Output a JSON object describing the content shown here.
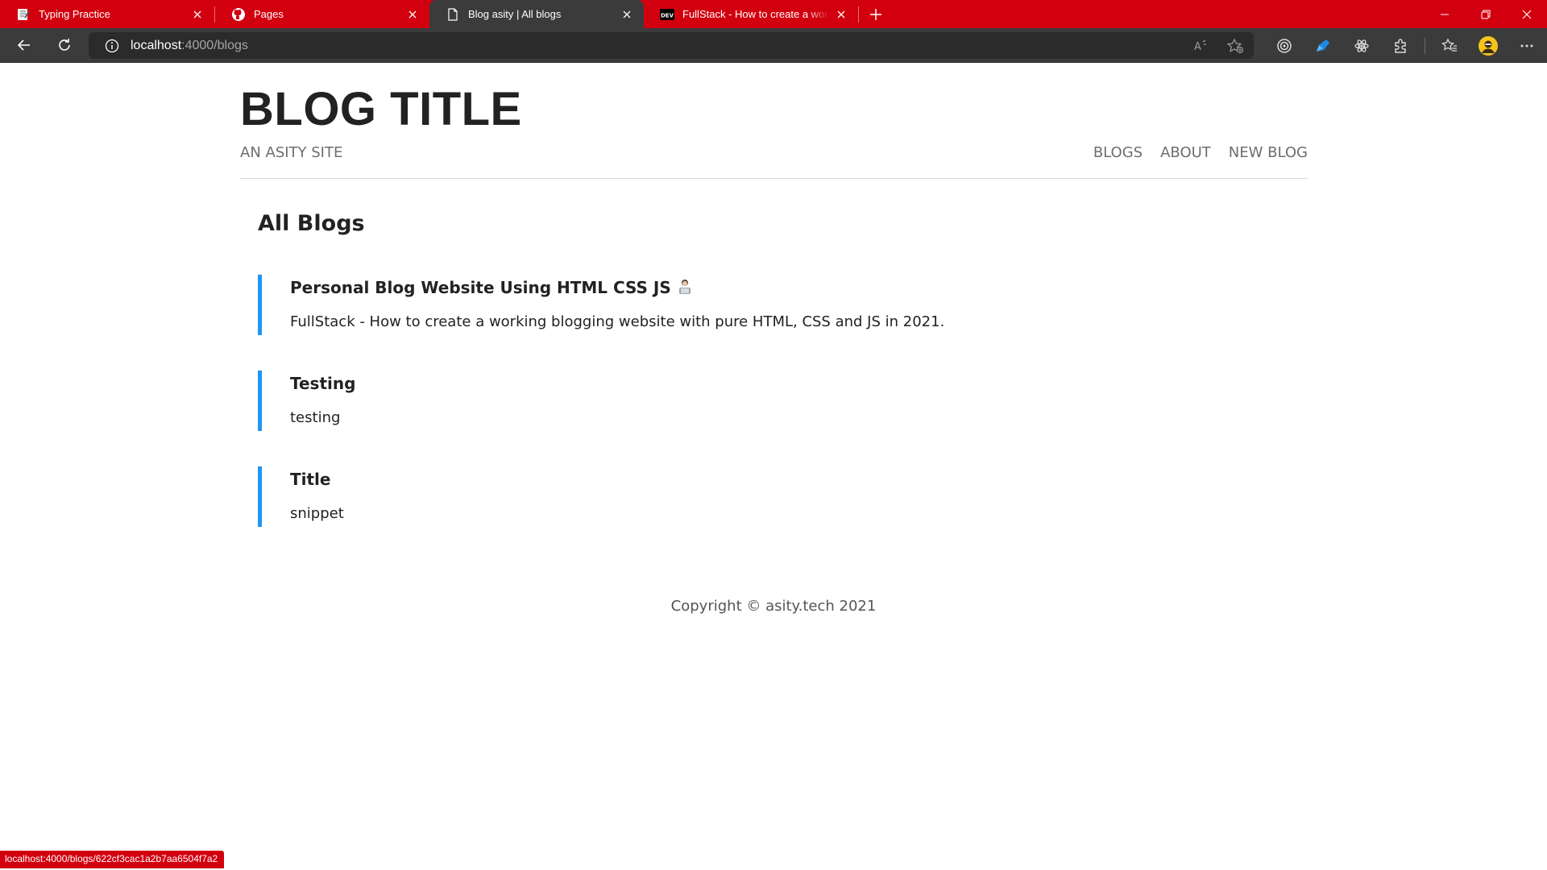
{
  "browser": {
    "tabs": [
      {
        "title": "Typing Practice",
        "icon": "notebook-icon",
        "active": false
      },
      {
        "title": "Pages",
        "icon": "github-icon",
        "active": false
      },
      {
        "title": "Blog asity | All blogs",
        "icon": "page-icon",
        "active": true
      },
      {
        "title": "FullStack - How to create a working blogging website",
        "icon": "dev-icon",
        "active": false
      }
    ],
    "dev_badge": "DEV",
    "url": {
      "host": "localhost",
      "path": ":4000/blogs"
    },
    "status_url": "localhost:4000/blogs/622cf3cac1a2b7aa6504f7a2",
    "colors": {
      "accent": "#d2000f",
      "toolbar": "#3b3b3b",
      "blog_bar": "#2196f3"
    }
  },
  "site": {
    "title": "BLOG TITLE",
    "subtitle": "AN ASITY SITE",
    "nav": [
      "BLOGS",
      "ABOUT",
      "NEW BLOG"
    ]
  },
  "main": {
    "heading": "All Blogs",
    "blogs": [
      {
        "title": "Personal Blog Website Using HTML CSS JS",
        "snippet": "FullStack - How to create a working blogging website with pure HTML, CSS and JS in 2021."
      },
      {
        "title": "Testing",
        "snippet": "testing"
      },
      {
        "title": "Title",
        "snippet": "snippet"
      }
    ]
  },
  "footer": {
    "copyright": "Copyright © asity.tech 2021"
  }
}
